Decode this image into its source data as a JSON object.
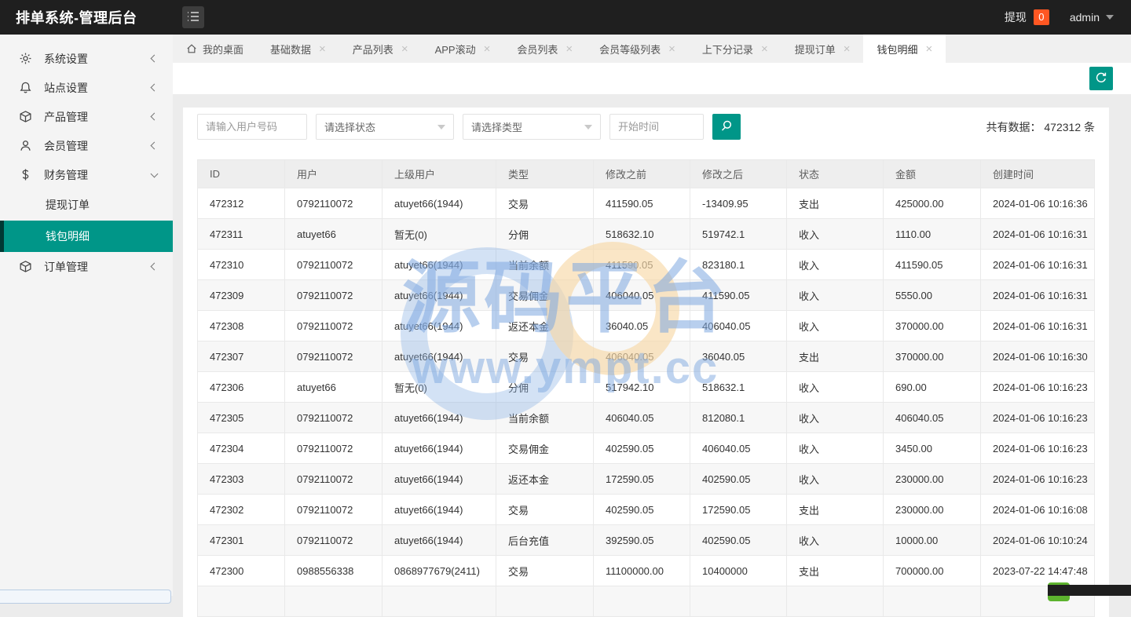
{
  "header": {
    "title": "排单系统-管理后台",
    "withdraw_label": "提现",
    "withdraw_badge": "0",
    "username": "admin"
  },
  "sidebar": {
    "items": [
      {
        "key": "system-settings",
        "label": "系统设置",
        "icon": "gear-icon",
        "state": "collapsed"
      },
      {
        "key": "site-settings",
        "label": "站点设置",
        "icon": "bell-icon",
        "state": "collapsed"
      },
      {
        "key": "product-management",
        "label": "产品管理",
        "icon": "cube-icon",
        "state": "collapsed"
      },
      {
        "key": "member-management",
        "label": "会员管理",
        "icon": "user-icon",
        "state": "collapsed"
      },
      {
        "key": "finance-management",
        "label": "财务管理",
        "icon": "dollar-icon",
        "state": "expanded",
        "children": [
          {
            "key": "withdraw-orders",
            "label": "提现订单",
            "active": false
          },
          {
            "key": "wallet-details",
            "label": "钱包明细",
            "active": true
          }
        ]
      },
      {
        "key": "order-management",
        "label": "订单管理",
        "icon": "cube-icon",
        "state": "collapsed"
      }
    ]
  },
  "tabs": [
    {
      "key": "my-desktop",
      "label": "我的桌面",
      "closable": false,
      "active": false,
      "icon": "home-icon"
    },
    {
      "key": "basic-data",
      "label": "基础数据",
      "closable": true,
      "active": false
    },
    {
      "key": "product-list",
      "label": "产品列表",
      "closable": true,
      "active": false
    },
    {
      "key": "app-scroll",
      "label": "APP滚动",
      "closable": true,
      "active": false
    },
    {
      "key": "member-list",
      "label": "会员列表",
      "closable": true,
      "active": false
    },
    {
      "key": "member-level-list",
      "label": "会员等级列表",
      "closable": true,
      "active": false
    },
    {
      "key": "updown-records",
      "label": "上下分记录",
      "closable": true,
      "active": false
    },
    {
      "key": "withdraw-orders",
      "label": "提现订单",
      "closable": true,
      "active": false
    },
    {
      "key": "wallet-details",
      "label": "钱包明细",
      "closable": true,
      "active": true
    }
  ],
  "filters": {
    "user_placeholder": "请输入用户号码",
    "status_select_value": "请选择状态",
    "type_select_value": "请选择类型",
    "start_time_placeholder": "开始时间",
    "total_label": "共有数据：",
    "total_count": "472312",
    "total_unit": "条"
  },
  "table": {
    "columns": [
      "ID",
      "用户",
      "上级用户",
      "类型",
      "修改之前",
      "修改之后",
      "状态",
      "金额",
      "创建时间"
    ],
    "rows": [
      [
        "472312",
        "0792110072",
        "atuyet66(1944)",
        "交易",
        "411590.05",
        "-13409.95",
        "支出",
        "425000.00",
        "2024-01-06 10:16:36"
      ],
      [
        "472311",
        "atuyet66",
        "暂无(0)",
        "分佣",
        "518632.10",
        "519742.1",
        "收入",
        "1110.00",
        "2024-01-06 10:16:31"
      ],
      [
        "472310",
        "0792110072",
        "atuyet66(1944)",
        "当前余额",
        "411590.05",
        "823180.1",
        "收入",
        "411590.05",
        "2024-01-06 10:16:31"
      ],
      [
        "472309",
        "0792110072",
        "atuyet66(1944)",
        "交易佣金",
        "406040.05",
        "411590.05",
        "收入",
        "5550.00",
        "2024-01-06 10:16:31"
      ],
      [
        "472308",
        "0792110072",
        "atuyet66(1944)",
        "返还本金",
        "36040.05",
        "406040.05",
        "收入",
        "370000.00",
        "2024-01-06 10:16:31"
      ],
      [
        "472307",
        "0792110072",
        "atuyet66(1944)",
        "交易",
        "406040.05",
        "36040.05",
        "支出",
        "370000.00",
        "2024-01-06 10:16:30"
      ],
      [
        "472306",
        "atuyet66",
        "暂无(0)",
        "分佣",
        "517942.10",
        "518632.1",
        "收入",
        "690.00",
        "2024-01-06 10:16:23"
      ],
      [
        "472305",
        "0792110072",
        "atuyet66(1944)",
        "当前余额",
        "406040.05",
        "812080.1",
        "收入",
        "406040.05",
        "2024-01-06 10:16:23"
      ],
      [
        "472304",
        "0792110072",
        "atuyet66(1944)",
        "交易佣金",
        "402590.05",
        "406040.05",
        "收入",
        "3450.00",
        "2024-01-06 10:16:23"
      ],
      [
        "472303",
        "0792110072",
        "atuyet66(1944)",
        "返还本金",
        "172590.05",
        "402590.05",
        "收入",
        "230000.00",
        "2024-01-06 10:16:23"
      ],
      [
        "472302",
        "0792110072",
        "atuyet66(1944)",
        "交易",
        "402590.05",
        "172590.05",
        "支出",
        "230000.00",
        "2024-01-06 10:16:08"
      ],
      [
        "472301",
        "0792110072",
        "atuyet66(1944)",
        "后台充值",
        "392590.05",
        "402590.05",
        "收入",
        "10000.00",
        "2024-01-06 10:10:24"
      ],
      [
        "472300",
        "0988556338",
        "0868977679(2411)",
        "交易",
        "11100000.00",
        "10400000",
        "支出",
        "700000.00",
        "2023-07-22 14:47:48"
      ],
      [
        "",
        "",
        "",
        "",
        "",
        "",
        "",
        "",
        ""
      ]
    ]
  },
  "watermark": {
    "text": "源码平台",
    "url": "www.ympt.cc"
  },
  "colors": {
    "accent": "#009688",
    "badge": "#ff5722",
    "header_bg": "#1f1f1f"
  }
}
